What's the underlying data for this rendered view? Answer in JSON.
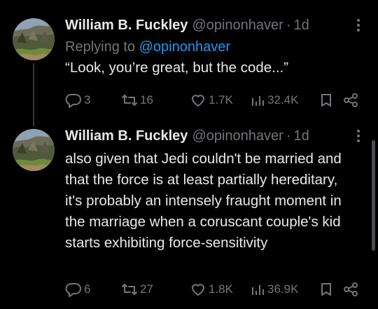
{
  "tweets": [
    {
      "display_name": "William B. Fuckley",
      "handle": "@opinonhaver",
      "separator": "·",
      "age": "1d",
      "replying_prefix": "Replying to",
      "replying_handle": "@opinonhaver",
      "text": "“Look, you’re great, but the code...”",
      "replies": "3",
      "retweets": "16",
      "likes": "1.7K",
      "views": "32.4K"
    },
    {
      "display_name": "William B. Fuckley",
      "handle": "@opinonhaver",
      "separator": "·",
      "age": "1d",
      "text": "also given that Jedi couldn't be married and that the force is at least partially hereditary, it's probably an intensely fraught moment in the marriage when a coruscant couple's kid starts exhibiting force-sensitivity",
      "replies": "6",
      "retweets": "27",
      "likes": "1.8K",
      "views": "36.9K"
    }
  ],
  "icons": {
    "more": "more-horizontal-icon",
    "reply": "reply-icon",
    "retweet": "retweet-icon",
    "like": "heart-icon",
    "views": "views-icon",
    "bookmark": "bookmark-icon",
    "share": "share-icon"
  },
  "colors": {
    "background": "#000000",
    "text": "#e7e9ea",
    "muted": "#71767b",
    "link": "#1d9bf0"
  }
}
